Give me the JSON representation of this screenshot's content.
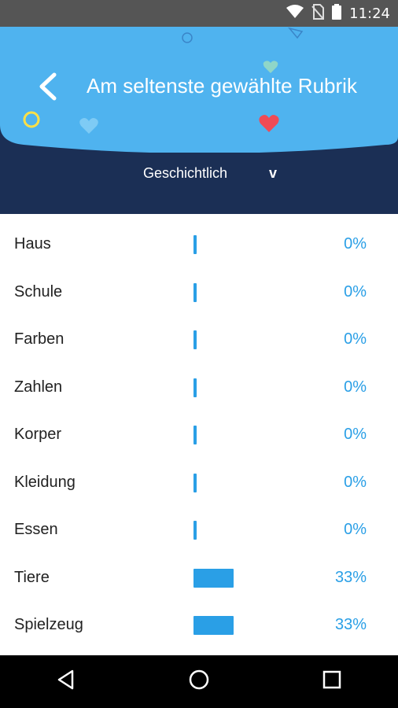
{
  "status_bar": {
    "time": "11:24",
    "icons": [
      "wifi-icon",
      "no-sim-icon",
      "battery-icon"
    ]
  },
  "header": {
    "title": "Am seltenste gewählte Rubrik",
    "back_icon": "chevron-left-icon",
    "colors": {
      "light_blue": "#4fb3ef",
      "dark_navy": "#1b2f55"
    }
  },
  "dropdown": {
    "selected": "Geschichtlich",
    "chevron": "v"
  },
  "rows": [
    {
      "label": "Haus",
      "percent": "0%",
      "fraction": 0
    },
    {
      "label": "Schule",
      "percent": "0%",
      "fraction": 0
    },
    {
      "label": "Farben",
      "percent": "0%",
      "fraction": 0
    },
    {
      "label": "Zahlen",
      "percent": "0%",
      "fraction": 0
    },
    {
      "label": "Korper",
      "percent": "0%",
      "fraction": 0
    },
    {
      "label": "Kleidung",
      "percent": "0%",
      "fraction": 0
    },
    {
      "label": "Essen",
      "percent": "0%",
      "fraction": 0
    },
    {
      "label": "Tiere",
      "percent": "33%",
      "fraction": 0.33
    },
    {
      "label": "Spielzeug",
      "percent": "33%",
      "fraction": 0.33
    }
  ],
  "accent_color": "#2a9fe6",
  "nav_bar": {
    "icons": [
      "back-triangle-icon",
      "home-circle-icon",
      "recents-square-icon"
    ]
  }
}
